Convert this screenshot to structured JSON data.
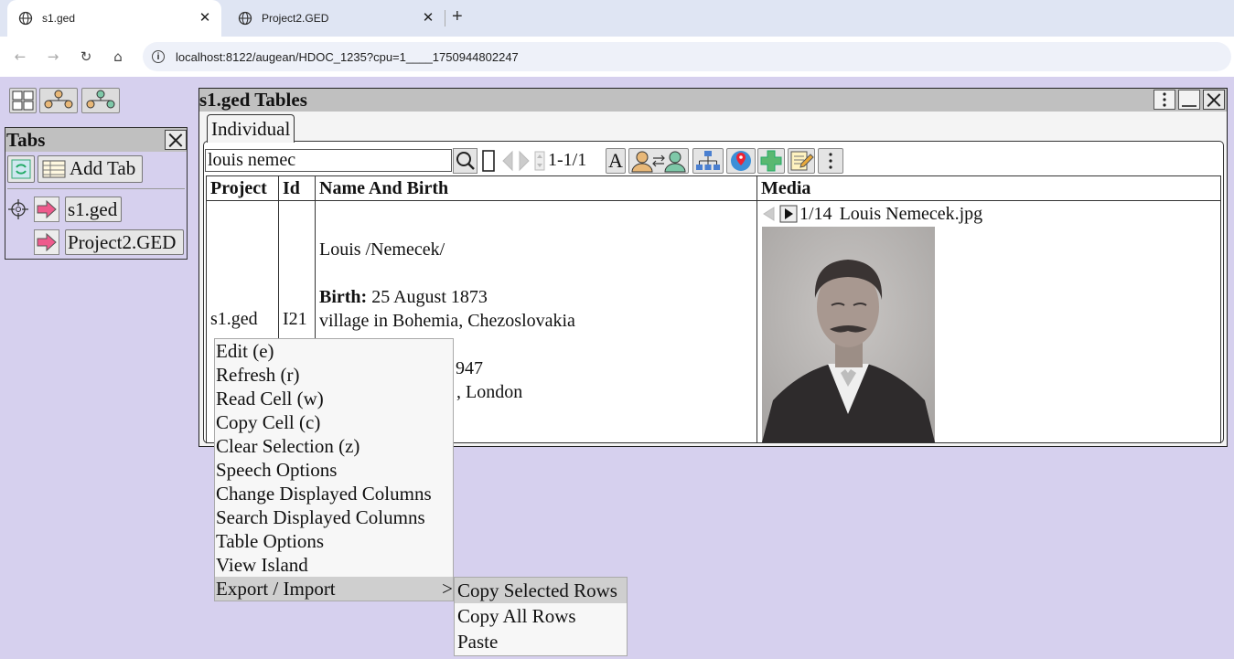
{
  "browser": {
    "tabs": [
      {
        "label": "s1.ged",
        "active": true
      },
      {
        "label": "Project2.GED",
        "active": false
      }
    ],
    "url": "localhost:8122/augean/HDOC_1235?cpu=1____1750944802247"
  },
  "tabs_panel": {
    "title": "Tabs",
    "add_tab_label": "Add Tab",
    "items": [
      {
        "label": "s1.ged"
      },
      {
        "label": "Project2.GED"
      }
    ]
  },
  "tables_window": {
    "title": "s1.ged Tables",
    "subtab": "Individual",
    "search_value": "louis nemec",
    "record_range": "1-1/1",
    "font_button": "A",
    "columns": [
      "Project",
      "Id",
      "Name And Birth",
      "Media"
    ],
    "row": {
      "project": "s1.ged",
      "id": "I21",
      "name": "Louis /Nemecek/",
      "birth_label": "Birth:",
      "birth_date": "25 August 1873",
      "birth_place": "village in Bohemia, Chezoslovakia",
      "death_partial": "947",
      "death_place_partial": ", London",
      "media_counter": "1/14",
      "media_filename": "Louis Nemecek.jpg"
    }
  },
  "context_menu": {
    "items": [
      "Edit (e)",
      "Refresh (r)",
      "Read Cell (w)",
      "Copy Cell (c)",
      "Clear Selection (z)",
      "Speech Options",
      "Change Displayed Columns",
      "Search Displayed Columns",
      "Table Options",
      "View Island",
      "Export / Import"
    ],
    "submenu_indicator": ">",
    "submenu": [
      "Copy Selected Rows",
      "Copy All Rows",
      "Paste"
    ]
  },
  "colors": {
    "page_bg": "#d6d0ee",
    "header_gray": "#c0c0c0",
    "menu_highlight": "#cfcfcf",
    "arrow_pink": "#ee5a8c"
  }
}
